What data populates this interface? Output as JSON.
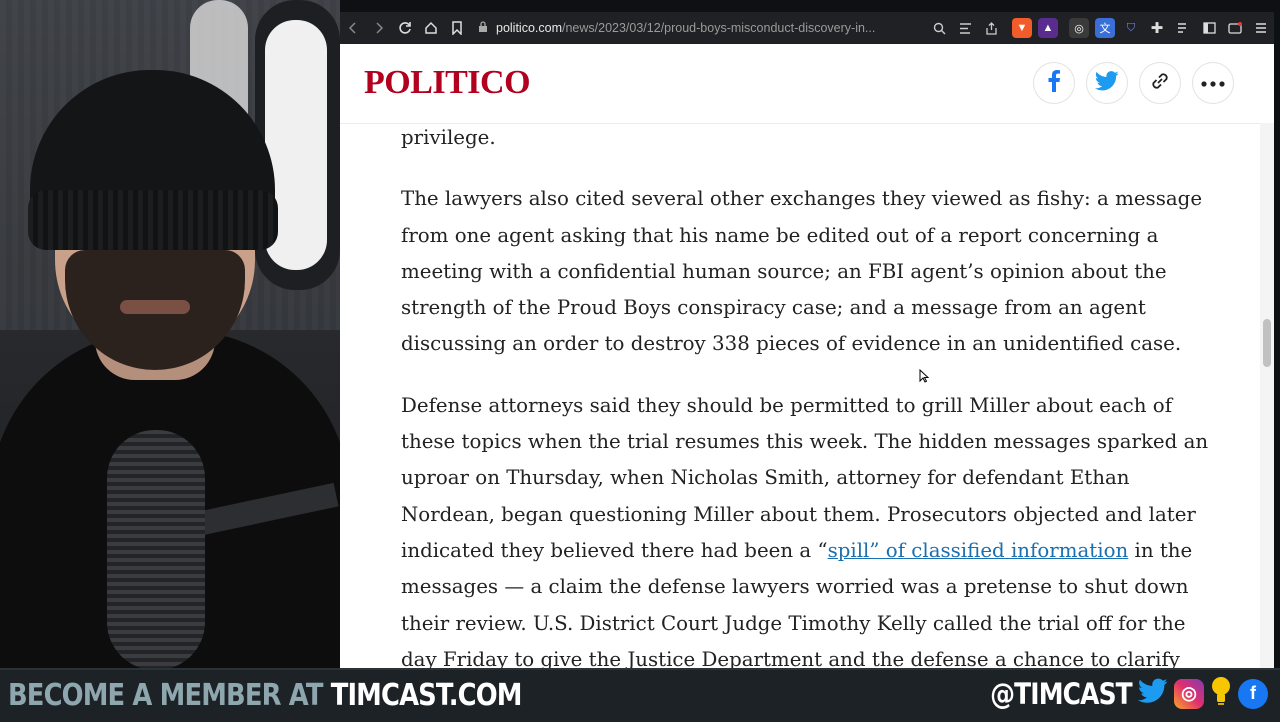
{
  "browser": {
    "url_host": "politico.com",
    "url_path": "/news/2023/03/12/proud-boys-misconduct-discovery-in..."
  },
  "site": {
    "logo": "POLITICO"
  },
  "article": {
    "p0": "privilege.",
    "p1": "The lawyers also cited several other exchanges they viewed as fishy: a message from one agent asking that his name be edited out of a report concerning a meeting with a confidential human source; an FBI agent’s opinion about the strength of the Proud Boys conspiracy case; and a message from an agent discussing an order to destroy 338 pieces of evidence in an unidentified case.",
    "p2_a": "Defense attorneys said they should be permitted to grill Miller about each of these topics when the trial resumes this week. The hidden messages sparked an uproar on Thursday, when Nicholas Smith, attorney for defendant Ethan Nordean, began questioning Miller about them. Prosecutors objected and later indicated they believed there had been a “",
    "p2_link": "spill” of classified information",
    "p2_b": " in the messages — a claim the defense lawyers worried was a pretense to shut down their review. U.S. District Court Judge Timothy Kelly called the trial off for the day Friday to give the Justice Department and the defense a chance to clarify"
  },
  "banner": {
    "left_prefix": "BECOME A MEMBER AT ",
    "left_site": "TIMCAST.COM",
    "handle": "@TIMCAST"
  },
  "colors": {
    "politico_red": "#b1011f",
    "link_blue": "#1a6fb0",
    "facebook_blue": "#1877f2",
    "twitter_blue": "#1d9bf0"
  }
}
